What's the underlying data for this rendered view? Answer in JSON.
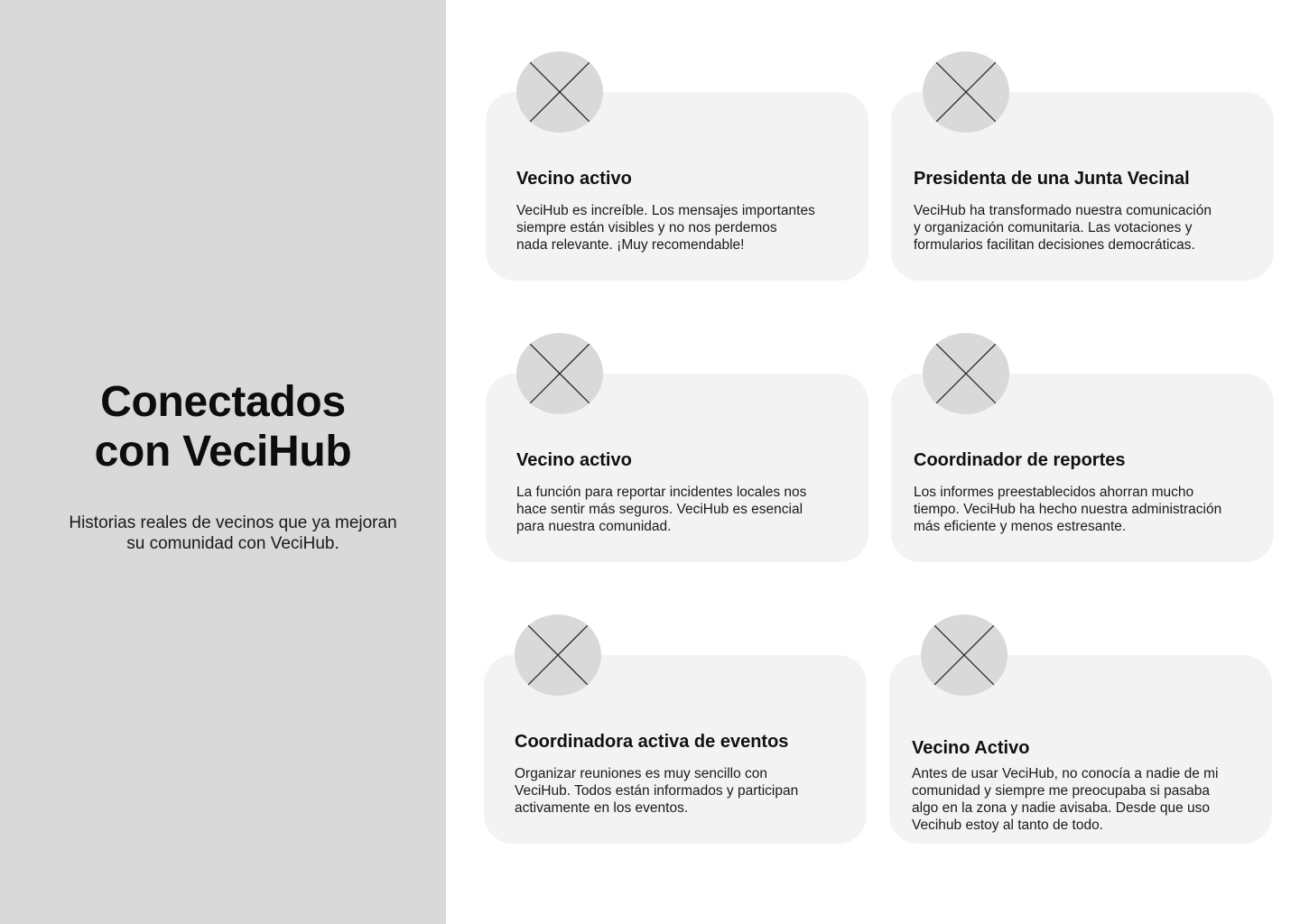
{
  "hero": {
    "title_line1": "Conectados",
    "title_line2": "con VeciHub",
    "subtitle_line1": "Historias reales de vecinos que ya mejoran",
    "subtitle_line2": "su comunidad con VeciHub."
  },
  "testimonials": [
    {
      "role": "Vecino activo",
      "text": "VeciHub es increíble. Los mensajes importantes\nsiempre están visibles y no nos perdemos\nnada relevante. ¡Muy recomendable!",
      "avatar_icon": "image-placeholder-icon"
    },
    {
      "role": "Presidenta de una Junta Vecinal",
      "text": "VeciHub ha transformado nuestra comunicación\n y organización comunitaria. Las votaciones y\nformularios facilitan decisiones democráticas.",
      "avatar_icon": "image-placeholder-icon"
    },
    {
      "role": "Vecino activo",
      "text": "La función para reportar incidentes locales nos\nhace sentir más seguros. VeciHub es esencial\npara nuestra comunidad.",
      "avatar_icon": "image-placeholder-icon"
    },
    {
      "role": "Coordinador de reportes",
      "text": "Los informes preestablecidos ahorran mucho\ntiempo. VeciHub ha hecho nuestra administración\n más eficiente y menos estresante.",
      "avatar_icon": "image-placeholder-icon"
    },
    {
      "role": "Coordinadora activa de eventos",
      "text": "Organizar reuniones es muy sencillo con\nVeciHub. Todos están informados y participan\nactivamente en los eventos.",
      "avatar_icon": "image-placeholder-icon"
    },
    {
      "role": "Vecino Activo",
      "text": "Antes de usar VeciHub, no conocía a nadie de mi\ncomunidad y siempre me preocupaba si pasaba\nalgo en la zona y nadie avisaba. Desde que uso\nVecihub estoy al tanto de todo.",
      "avatar_icon": "image-placeholder-icon"
    }
  ],
  "colors": {
    "sidebar_bg": "#d9d9d9",
    "card_bg": "#f3f3f3",
    "avatar_bg": "#d9d9d9",
    "text": "#111111"
  }
}
